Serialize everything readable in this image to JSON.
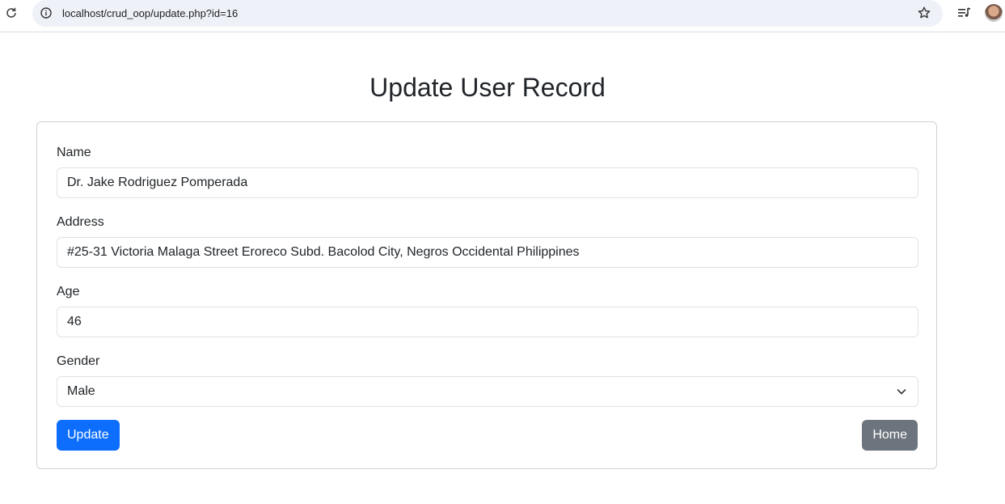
{
  "browser": {
    "url": "localhost/crud_oop/update.php?id=16"
  },
  "page": {
    "title": "Update User Record"
  },
  "form": {
    "name_label": "Name",
    "name_value": "Dr. Jake Rodriguez Pomperada",
    "address_label": "Address",
    "address_value": "#25-31 Victoria Malaga Street Eroreco Subd. Bacolod City, Negros Occidental Philippines",
    "age_label": "Age",
    "age_value": "46",
    "gender_label": "Gender",
    "gender_value": "Male",
    "update_label": "Update",
    "home_label": "Home"
  },
  "colors": {
    "primary": "#0d6efd",
    "secondary": "#6c757d"
  }
}
